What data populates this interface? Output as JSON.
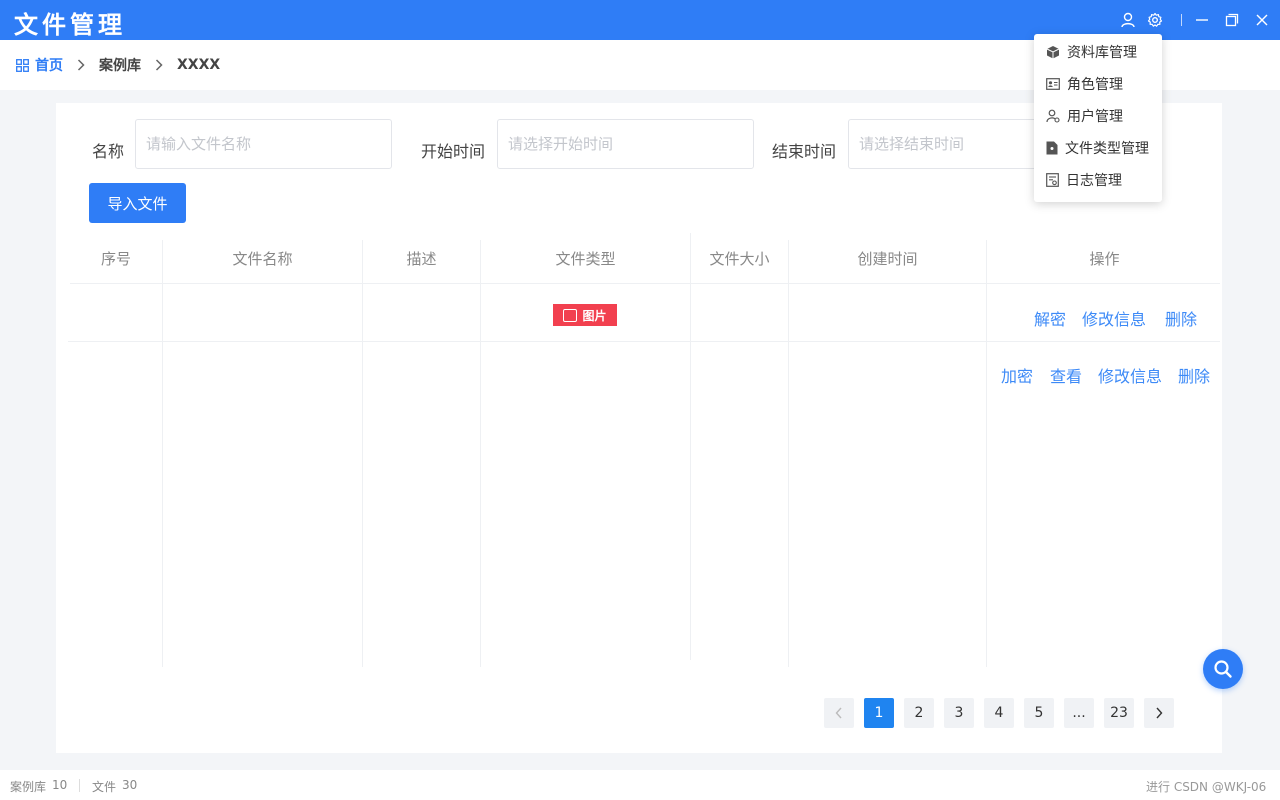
{
  "app": {
    "title": "文件管理"
  },
  "breadcrumb": {
    "home": "首页",
    "items": [
      "案例库",
      "XXXX"
    ]
  },
  "filters": {
    "name_label": "名称",
    "name_placeholder": "请输入文件名称",
    "start_label": "开始时间",
    "start_placeholder": "请选择开始时间",
    "end_label": "结束时间",
    "end_placeholder": "请选择结束时间"
  },
  "toolbar": {
    "import_label": "导入文件"
  },
  "table": {
    "columns": [
      "序号",
      "文件名称",
      "描述",
      "文件类型",
      "文件大小",
      "创建时间",
      "操作"
    ],
    "rows": [
      {
        "file_type": "图片",
        "actions": [
          "解密",
          "修改信息",
          "删除"
        ]
      },
      {
        "file_type": "",
        "actions": [
          "加密",
          "查看",
          "修改信息",
          "删除"
        ]
      }
    ]
  },
  "pagination": {
    "pages": [
      "1",
      "2",
      "3",
      "4",
      "5",
      "...",
      "23"
    ],
    "current": "1"
  },
  "menu": {
    "items": [
      {
        "label": "资料库管理",
        "icon": "cube-icon"
      },
      {
        "label": "角色管理",
        "icon": "id-card-icon"
      },
      {
        "label": "用户管理",
        "icon": "user-gear-icon"
      },
      {
        "label": "文件类型管理",
        "icon": "file-type-icon"
      },
      {
        "label": "日志管理",
        "icon": "log-icon"
      }
    ]
  },
  "status": {
    "cases_label": "案例库",
    "cases_count": "10",
    "files_label": "文件",
    "files_count": "30",
    "right": "进行 CSDN @WKJ-06"
  },
  "colors": {
    "primary": "#2f7df6",
    "danger": "#f2404f",
    "link": "#3d8af7",
    "active_page": "#1f84f0"
  }
}
